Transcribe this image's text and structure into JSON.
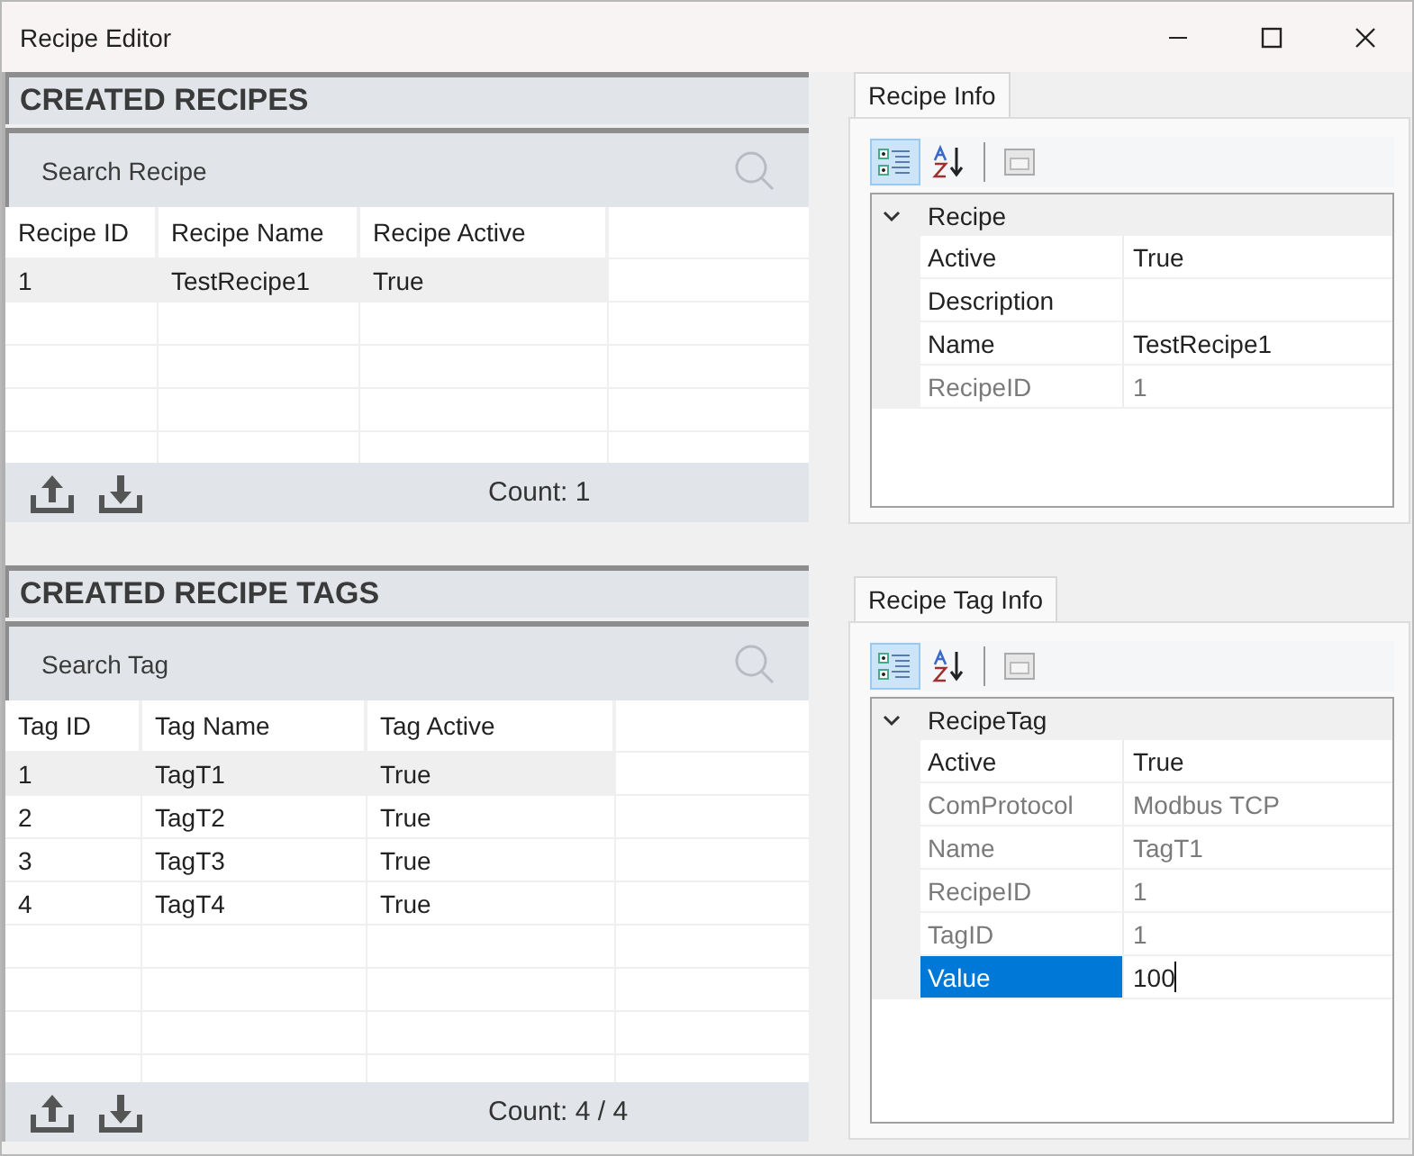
{
  "window": {
    "title": "Recipe Editor"
  },
  "recipes": {
    "heading": "CREATED RECIPES",
    "search": {
      "placeholder": "Search Recipe"
    },
    "columns": [
      "Recipe ID",
      "Recipe Name",
      "Recipe Active"
    ],
    "rows": [
      {
        "cells": [
          "1",
          "TestRecipe1",
          "True"
        ],
        "selected": true
      }
    ],
    "count": "Count: 1"
  },
  "recipe_info": {
    "tab": {
      "label": "Recipe Info",
      "selected": true
    },
    "categorized": true,
    "category": {
      "label": "Recipe",
      "expanded": true
    },
    "properties": [
      {
        "name": "Active",
        "value": "True",
        "readonly": false,
        "selected": false
      },
      {
        "name": "Description",
        "readonly": false,
        "selected": false
      },
      {
        "name": "Name",
        "value": "TestRecipe1",
        "readonly": false,
        "selected": false
      },
      {
        "name": "RecipeID",
        "value": "1",
        "readonly": true,
        "selected": false
      }
    ]
  },
  "recipe_tags": {
    "heading": "CREATED RECIPE TAGS",
    "search": {
      "placeholder": "Search Tag"
    },
    "columns": [
      "Tag ID",
      "Tag Name",
      "Tag Active"
    ],
    "rows": [
      {
        "cells": [
          "1",
          "TagT1",
          "True"
        ],
        "selected": true
      },
      {
        "cells": [
          "2",
          "TagT2",
          "True"
        ],
        "selected": false
      },
      {
        "cells": [
          "3",
          "TagT3",
          "True"
        ],
        "selected": false
      },
      {
        "cells": [
          "4",
          "TagT4",
          "True"
        ],
        "selected": false
      }
    ],
    "count": "Count: 4 / 4"
  },
  "recipe_tag_info": {
    "tab": {
      "label": "Recipe Tag Info",
      "selected": true
    },
    "categorized": true,
    "category": {
      "label": "RecipeTag",
      "expanded": true
    },
    "properties": [
      {
        "name": "Active",
        "value": "True",
        "readonly": false,
        "selected": false
      },
      {
        "name": "ComProtocol",
        "value": "Modbus TCP",
        "readonly": true,
        "selected": false
      },
      {
        "name": "Name",
        "value": "TagT1",
        "readonly": true,
        "selected": false
      },
      {
        "name": "RecipeID",
        "value": "1",
        "readonly": true,
        "selected": false
      },
      {
        "name": "TagID",
        "value": "1",
        "readonly": true,
        "selected": false
      },
      {
        "name": "Value",
        "value": "100",
        "readonly": false,
        "selected": true
      }
    ]
  }
}
